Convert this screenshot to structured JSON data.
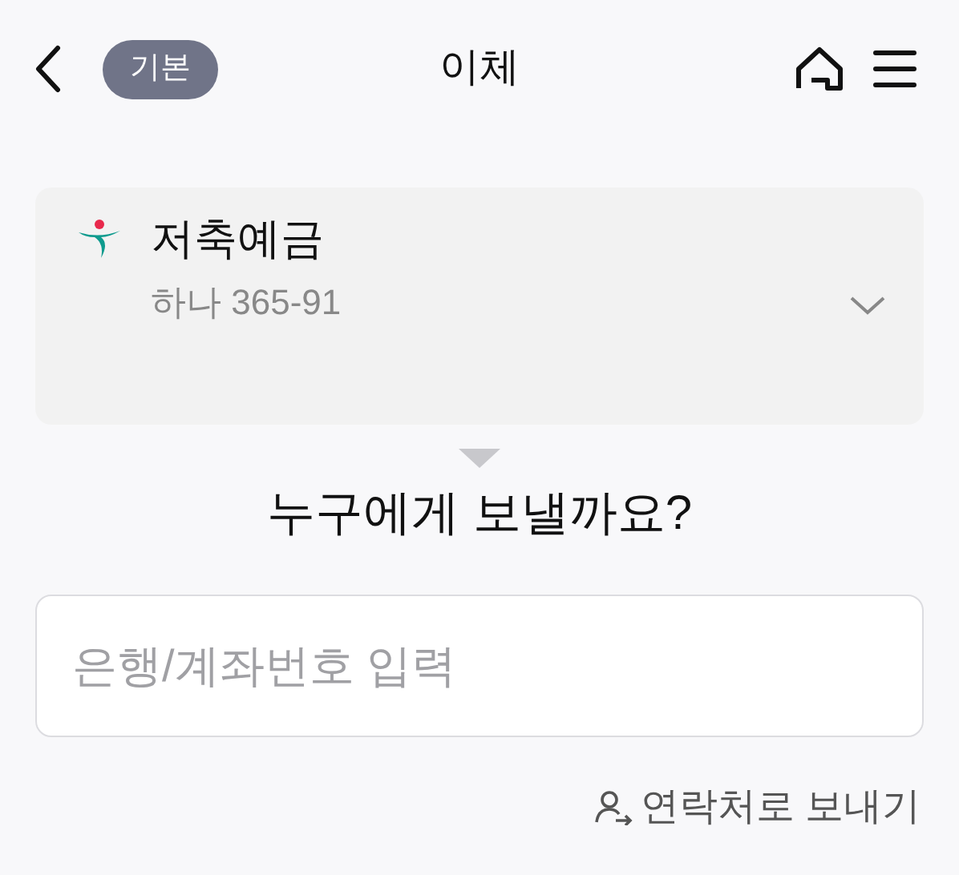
{
  "header": {
    "badge": "기본",
    "title": "이체"
  },
  "account": {
    "name": "저축예금",
    "number": "하나 365-91"
  },
  "heading": "누구에게 보낼까요?",
  "search": {
    "placeholder": "은행/계좌번호 입력"
  },
  "contact_link": "연락처로 보내기"
}
